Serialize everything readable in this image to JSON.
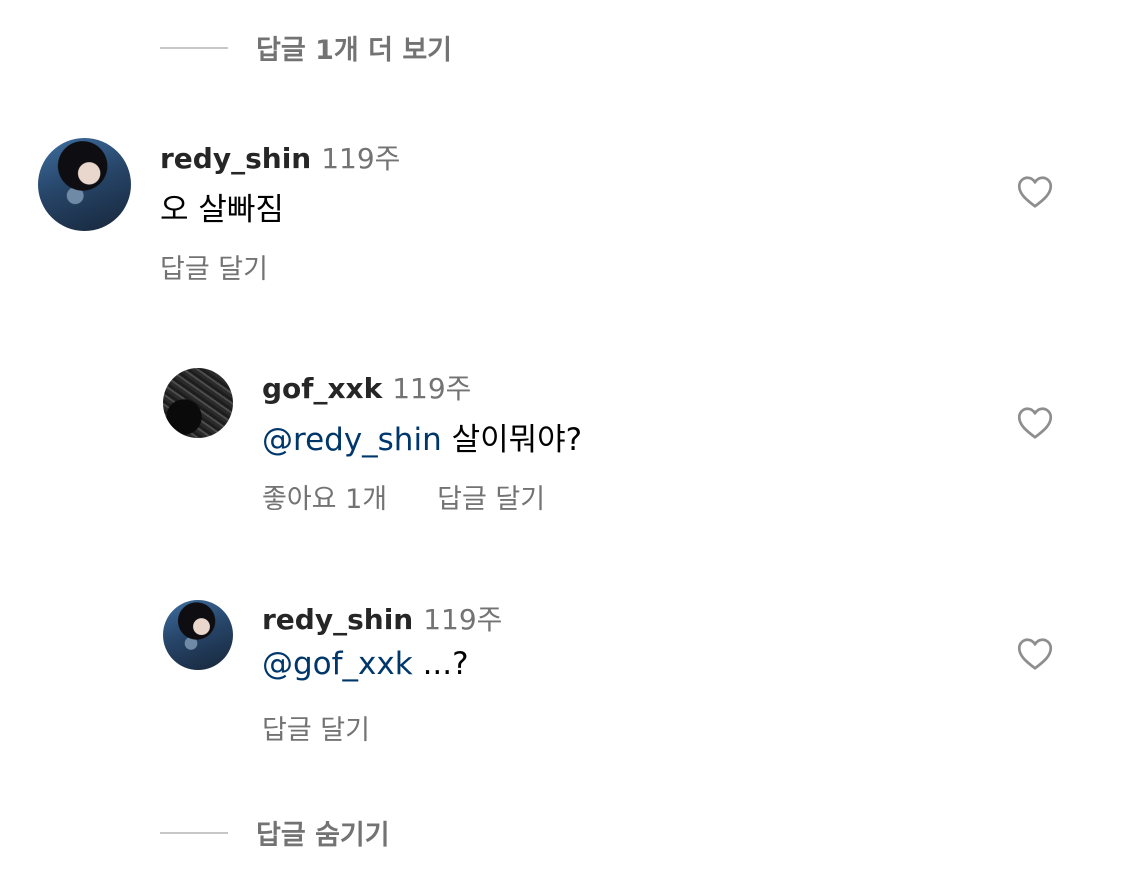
{
  "replies": {
    "view_more_label": "답글 1개 더 보기",
    "hide_label": "답글 숨기기"
  },
  "comments": [
    {
      "username": "redy_shin",
      "time": "119주",
      "mention": "",
      "text": "오 살빠짐",
      "likes_label": "",
      "reply_label": "답글 달기",
      "avatar": "redy-shin-avatar"
    },
    {
      "username": "gof_xxk",
      "time": "119주",
      "mention": "@redy_shin",
      "text": "살이뭐야?",
      "likes_label": "좋아요 1개",
      "reply_label": "답글 달기",
      "avatar": "gof-xxk-avatar"
    },
    {
      "username": "redy_shin",
      "time": "119주",
      "mention": "@gof_xxk",
      "text": "...?",
      "likes_label": "",
      "reply_label": "답글 달기",
      "avatar": "redy-shin-avatar"
    }
  ],
  "icons": {
    "like": "heart-outline-icon"
  },
  "colors": {
    "mention": "#00376b",
    "secondary_text": "#737373",
    "divider": "#c7c7c7"
  }
}
